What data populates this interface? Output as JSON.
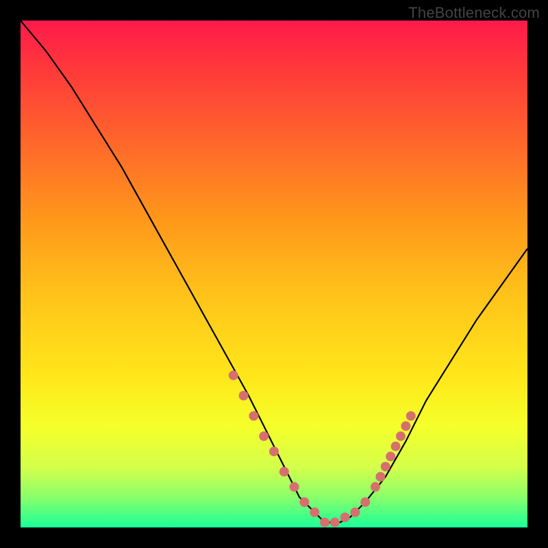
{
  "watermark": "TheBottleneck.com",
  "chart_data": {
    "type": "line",
    "title": "",
    "xlabel": "",
    "ylabel": "",
    "xlim": [
      0,
      100
    ],
    "ylim": [
      0,
      100
    ],
    "series": [
      {
        "name": "bottleneck-curve",
        "x": [
          0,
          5,
          10,
          15,
          20,
          25,
          30,
          35,
          40,
          45,
          50,
          53,
          55,
          58,
          60,
          63,
          65,
          68,
          72,
          76,
          80,
          85,
          90,
          95,
          100
        ],
        "y": [
          100,
          94,
          87,
          79,
          71,
          62,
          53,
          44,
          35,
          26,
          16,
          10,
          6,
          3,
          1,
          1,
          2,
          5,
          10,
          17,
          25,
          33,
          41,
          48,
          55
        ]
      }
    ],
    "markers": {
      "name": "highlight-dots",
      "color": "#d6706e",
      "x": [
        42,
        44,
        46,
        48,
        50,
        52,
        54,
        56,
        58,
        60,
        62,
        64,
        66,
        68,
        70,
        71,
        72,
        73,
        74,
        75,
        76,
        77
      ],
      "y": [
        30,
        26,
        22,
        18,
        15,
        11,
        8,
        5,
        3,
        1,
        1,
        2,
        3,
        5,
        8,
        10,
        12,
        14,
        16,
        18,
        20,
        22
      ]
    }
  }
}
